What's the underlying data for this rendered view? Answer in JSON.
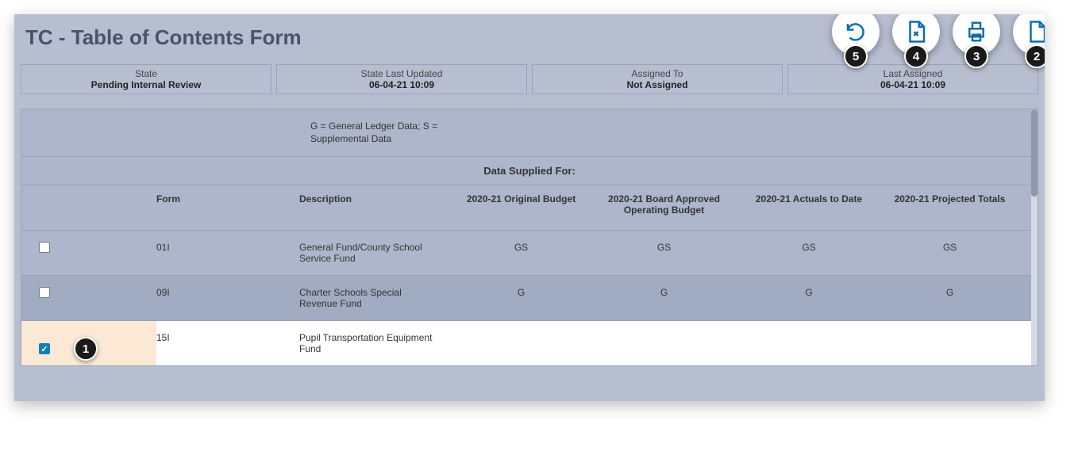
{
  "title": "TC - Table of Contents Form",
  "status": [
    {
      "label": "State",
      "value": "Pending Internal Review"
    },
    {
      "label": "State Last Updated",
      "value": "06-04-21 10:09"
    },
    {
      "label": "Assigned To",
      "value": "Not Assigned"
    },
    {
      "label": "Last Assigned",
      "value": "06-04-21 10:09"
    }
  ],
  "legend": "G = General Ledger Data; S = Supplemental Data",
  "supplied_header": "Data Supplied For:",
  "columns": {
    "form": "Form",
    "desc": "Description",
    "d1": "2020-21 Original Budget",
    "d2": "2020-21 Board Approved Operating Budget",
    "d3": "2020-21 Actuals to Date",
    "d4": "2020-21 Projected Totals"
  },
  "rows": [
    {
      "checked": false,
      "form": "01I",
      "desc": "General Fund/County School Service Fund",
      "d1": "GS",
      "d2": "GS",
      "d3": "GS",
      "d4": "GS",
      "selected": false,
      "parity": "even"
    },
    {
      "checked": false,
      "form": "09I",
      "desc": "Charter Schools Special Revenue Fund",
      "d1": "G",
      "d2": "G",
      "d3": "G",
      "d4": "G",
      "selected": false,
      "parity": "odd"
    },
    {
      "checked": true,
      "form": "15I",
      "desc": "Pupil Transportation Equipment Fund",
      "d1": "",
      "d2": "",
      "d3": "",
      "d4": "",
      "selected": true,
      "parity": "even"
    }
  ],
  "callouts": {
    "row": "1",
    "toolbar": [
      "5",
      "4",
      "3",
      "2"
    ]
  }
}
